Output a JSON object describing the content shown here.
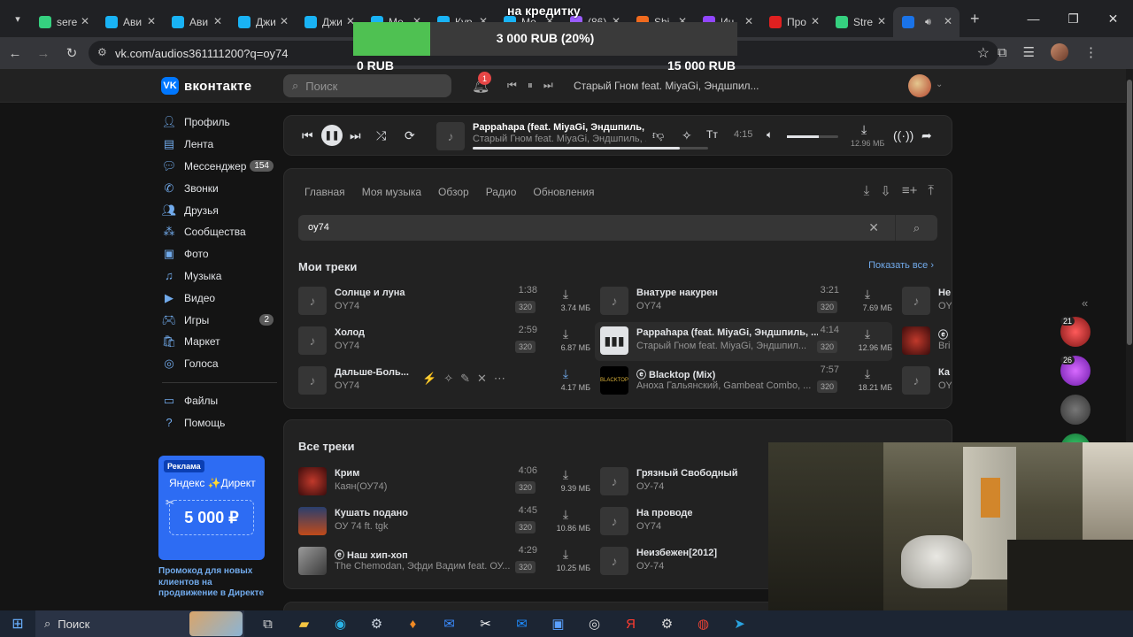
{
  "browser": {
    "tabs": [
      {
        "label": "sere",
        "color": "#35d07f",
        "active": false
      },
      {
        "label": "Ави",
        "color": "#19b3f5",
        "active": false
      },
      {
        "label": "Ави",
        "color": "#19b3f5",
        "active": false
      },
      {
        "label": "Джи",
        "color": "#19b3f5",
        "active": false
      },
      {
        "label": "Джи",
        "color": "#19b3f5",
        "active": false
      },
      {
        "label": "Ме",
        "color": "#19b3f5",
        "active": false
      },
      {
        "label": "Кур",
        "color": "#19b3f5",
        "active": false
      },
      {
        "label": "Ме",
        "color": "#19b3f5",
        "active": false
      },
      {
        "label": "(86)",
        "color": "#9a5cff",
        "active": false
      },
      {
        "label": "Shi",
        "color": "#f06a1e",
        "active": false
      },
      {
        "label": "Ин",
        "color": "#9146ff",
        "active": false
      },
      {
        "label": "Про",
        "color": "#e02020",
        "active": false
      },
      {
        "label": "Stre",
        "color": "#35d07f",
        "active": false
      },
      {
        "label": "",
        "color": "#1a73e8",
        "active": true
      }
    ],
    "url": "vk.com/audios361111200?q=oy74"
  },
  "donation": {
    "title": "на кредитку",
    "current": "3 000 RUB (20%)",
    "progress_pct": 20,
    "min": "0 RUB",
    "max": "15 000 RUB"
  },
  "header": {
    "logo": "вконтакте",
    "search_placeholder": "Поиск",
    "notif_count": "1",
    "now_playing": "Старый Гном feat. MiyaGi, Эндшпил..."
  },
  "sidebar": {
    "items": [
      {
        "label": "Профиль",
        "icon": "user-icon",
        "count": ""
      },
      {
        "label": "Лента",
        "icon": "news-icon",
        "count": ""
      },
      {
        "label": "Мессенджер",
        "icon": "chat-icon",
        "count": "154"
      },
      {
        "label": "Звонки",
        "icon": "phone-icon",
        "count": ""
      },
      {
        "label": "Друзья",
        "icon": "friends-icon",
        "count": ""
      },
      {
        "label": "Сообщества",
        "icon": "groups-icon",
        "count": ""
      },
      {
        "label": "Фото",
        "icon": "photo-icon",
        "count": ""
      },
      {
        "label": "Музыка",
        "icon": "music-icon",
        "count": ""
      },
      {
        "label": "Видео",
        "icon": "video-icon",
        "count": ""
      },
      {
        "label": "Игры",
        "icon": "games-icon",
        "count": "2"
      },
      {
        "label": "Маркет",
        "icon": "market-icon",
        "count": ""
      },
      {
        "label": "Голоса",
        "icon": "coins-icon",
        "count": ""
      }
    ],
    "items2": [
      {
        "label": "Файлы",
        "icon": "files-icon"
      },
      {
        "label": "Помощь",
        "icon": "help-icon"
      }
    ],
    "ad": {
      "label": "Реклама",
      "title": "Яндекс ✨Директ",
      "amount": "5 000 ₽",
      "text": "Промокод для новых клиентов на продвижение в Директе"
    }
  },
  "player": {
    "title": "Pappahapa (feat. MiyaGi, Эндшпиль, ...",
    "artist": "Старый Гном feat. MiyaGi, Эндшпиль, ...",
    "time": "4:15",
    "size": "12.96 МБ",
    "progress": 0.88,
    "volume": 0.62
  },
  "panel": {
    "tabs": [
      "Главная",
      "Моя музыка",
      "Обзор",
      "Радио",
      "Обновления"
    ],
    "search_value": "oy74",
    "my_tracks_title": "Мои треки",
    "show_all": "Показать все",
    "my_tracks": [
      {
        "title": "Солнце и луна",
        "artist": "OY74",
        "dur": "1:38",
        "q": "320",
        "size": "3.74 МБ",
        "cover": "note"
      },
      {
        "title": "Холод",
        "artist": "OY74",
        "dur": "2:59",
        "q": "320",
        "size": "6.87 МБ",
        "cover": "note"
      },
      {
        "title": "Дальше-Боль...",
        "artist": "OY74",
        "dur": "",
        "q": "",
        "size": "4.17 МБ",
        "cover": "note",
        "hover": true
      },
      {
        "title": "Внатуре накурен",
        "artist": "OY74",
        "dur": "3:21",
        "q": "320",
        "size": "7.69 МБ",
        "cover": "note"
      },
      {
        "title": "Pappahapa (feat. MiyaGi, Эндшпиль, ...",
        "artist": "Старый Гном feat. MiyaGi, Эндшпил...",
        "dur": "4:14",
        "q": "320",
        "size": "12.96 МБ",
        "cover": "playing",
        "current": true
      },
      {
        "title": "ⓔ Blacktop (Mix)",
        "artist": "Аноха Гальянский, Gambeat Combo, ...",
        "dur": "7:57",
        "q": "320",
        "size": "18.21 МБ",
        "cover": "black"
      },
      {
        "title": "Не",
        "artist": "OY",
        "dur": "",
        "q": "",
        "size": "",
        "cover": "note"
      },
      {
        "title": "ⓔ",
        "artist": "Bri",
        "dur": "",
        "q": "",
        "size": "",
        "cover": "red"
      },
      {
        "title": "Ка",
        "artist": "OY",
        "dur": "",
        "q": "",
        "size": "",
        "cover": "note"
      }
    ],
    "all_tracks_title": "Все треки",
    "all_tracks": [
      {
        "title": "Крим",
        "artist": "Каян(ОУ74)",
        "dur": "4:06",
        "q": "320",
        "size": "9.39 МБ",
        "cover": "red"
      },
      {
        "title": "Кушать подано",
        "artist": "ОУ 74 ft. tgk",
        "dur": "4:45",
        "q": "320",
        "size": "10.86 МБ",
        "cover": "fire"
      },
      {
        "title": "ⓔ Наш хип-хоп",
        "artist": "The Chemodan, Эфди Вадим feat. ОУ...",
        "dur": "4:29",
        "q": "320",
        "size": "10.25 МБ",
        "cover": "gray"
      },
      {
        "title": "Грязный Свободный",
        "artist": "ОУ-74",
        "dur": "",
        "q": "",
        "size": "",
        "cover": "note"
      },
      {
        "title": "На проводе",
        "artist": "OY74",
        "dur": "",
        "q": "",
        "size": "",
        "cover": "note"
      },
      {
        "title": "Неизбежен[2012]",
        "artist": "ОУ-74",
        "dur": "",
        "q": "",
        "size": "",
        "cover": "note"
      }
    ]
  },
  "right_bubbles": [
    "21",
    "26",
    "",
    ""
  ],
  "taskbar": {
    "search": "Поиск",
    "apps": [
      "task-view-icon",
      "explorer-icon",
      "edge-icon",
      "steam-icon",
      "fire-icon",
      "mail-icon",
      "capcut-icon",
      "outlook-icon",
      "store-icon",
      "obs-icon",
      "yandex-icon",
      "settings-icon",
      "chrome-icon",
      "telegram-icon"
    ]
  }
}
